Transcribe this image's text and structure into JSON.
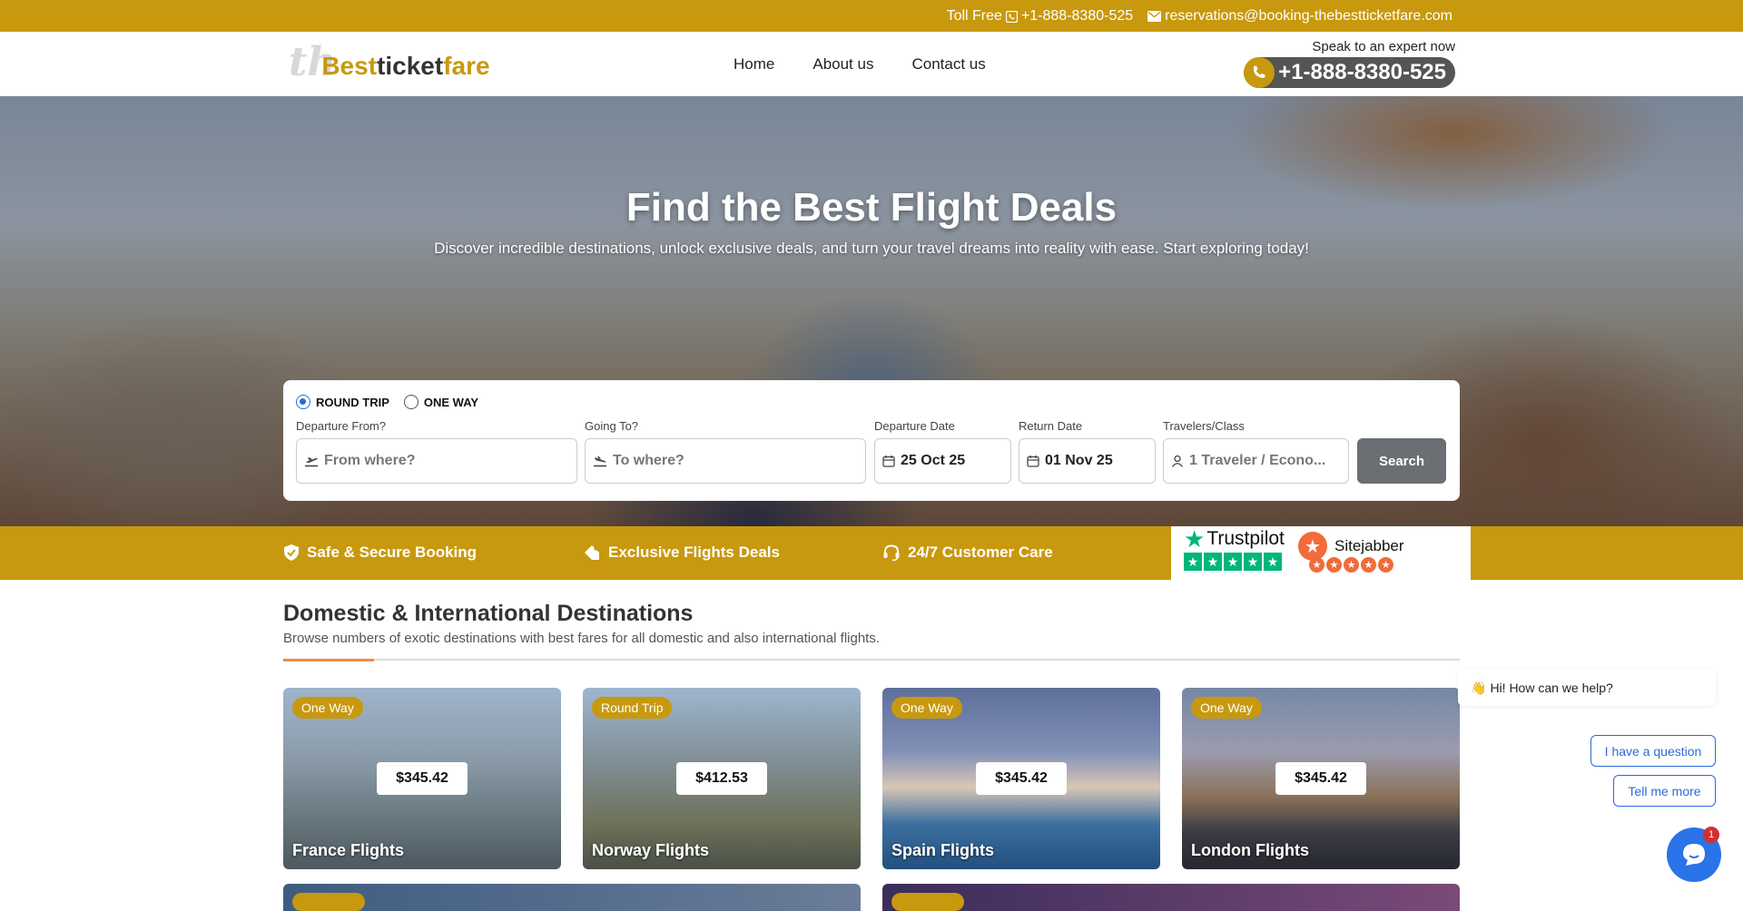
{
  "topbar": {
    "toll_free_label": "Toll Free",
    "phone": "+1-888-8380-525",
    "email": "reservations@booking-thebestticketfare.com"
  },
  "header": {
    "logo": {
      "prefix": "th",
      "part1": "Best",
      "part2": "ticket",
      "part3": "fare"
    },
    "nav": [
      "Home",
      "About us",
      "Contact us"
    ],
    "expert_label": "Speak to an expert now",
    "expert_phone": "+1-888-8380-525"
  },
  "hero": {
    "title": "Find the Best Flight Deals",
    "subtitle": "Discover incredible destinations, unlock exclusive deals, and turn your travel dreams into reality with ease. Start exploring today!"
  },
  "search": {
    "trip_types": [
      "ROUND TRIP",
      "ONE WAY"
    ],
    "selected_trip": "ROUND TRIP",
    "from": {
      "label": "Departure From?",
      "placeholder": "From where?"
    },
    "to": {
      "label": "Going To?",
      "placeholder": "To where?"
    },
    "departure": {
      "label": "Departure Date",
      "value": "25 Oct 25"
    },
    "return": {
      "label": "Return Date",
      "value": "01 Nov 25"
    },
    "travelers": {
      "label": "Travelers/Class",
      "value": "1 Traveler / Econo..."
    },
    "button": "Search"
  },
  "features": [
    "Safe & Secure Booking",
    "Exclusive Flights Deals",
    "24/7 Customer Care"
  ],
  "ratings": {
    "trustpilot": "Trustpilot",
    "sitejabber": "Sitejabber"
  },
  "destinations": {
    "title": "Domestic & International Destinations",
    "subtitle": "Browse numbers of exotic destinations with best fares for all domestic and also international flights.",
    "cards": [
      {
        "tag": "One Way",
        "price": "$345.42",
        "name": "France Flights"
      },
      {
        "tag": "Round Trip",
        "price": "$412.53",
        "name": "Norway Flights"
      },
      {
        "tag": "One Way",
        "price": "$345.42",
        "name": "Spain Flights"
      },
      {
        "tag": "One Way",
        "price": "$345.42",
        "name": "London Flights"
      }
    ]
  },
  "chat": {
    "greeting": "Hi! How can we help?",
    "options": [
      "I have a question",
      "Tell me more"
    ],
    "unread": "1"
  },
  "colors": {
    "brand": "#c8990e",
    "accent": "#f08a45",
    "chat_blue": "#2a6ad8"
  }
}
